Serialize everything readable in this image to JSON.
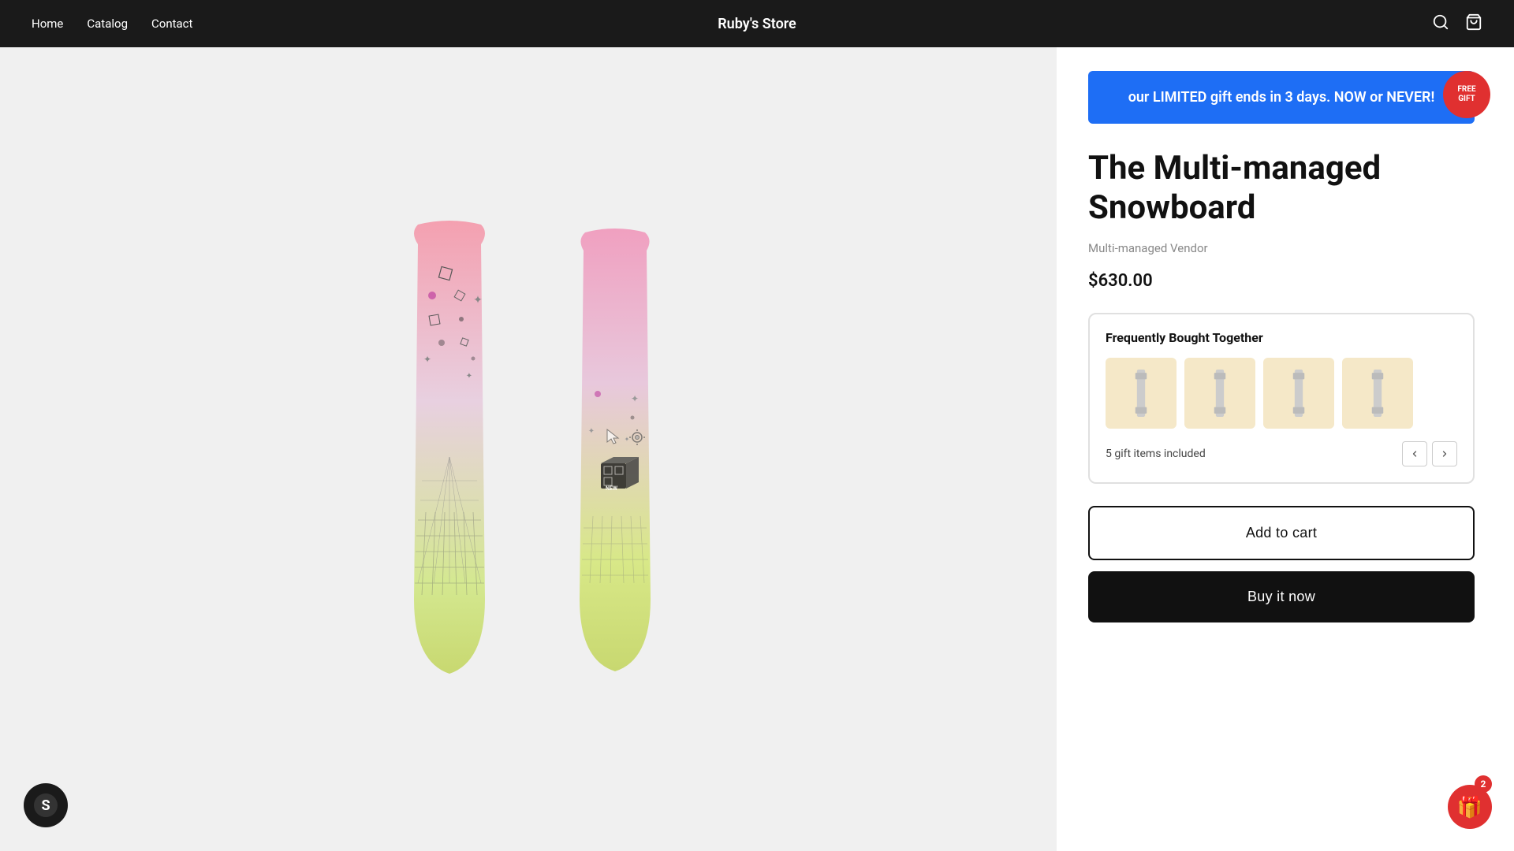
{
  "header": {
    "brand": "Ruby's Store",
    "nav": [
      {
        "label": "Home",
        "href": "#"
      },
      {
        "label": "Catalog",
        "href": "#"
      },
      {
        "label": "Contact",
        "href": "#"
      }
    ],
    "search_label": "Search",
    "cart_label": "Cart"
  },
  "banner": {
    "text": "our LIMITED gift ends in 3 days. NOW or NEVER!"
  },
  "product": {
    "title": "The Multi-managed Snowboard",
    "vendor": "Multi-managed Vendor",
    "price": "$630.00",
    "free_gift_badge_line1": "FREE",
    "free_gift_badge_line2": "GIFT"
  },
  "fbt": {
    "title": "Frequently Bought Together",
    "items_count_label": "5 gift items included",
    "item_count": 4
  },
  "buttons": {
    "add_to_cart": "Add to cart",
    "buy_now": "Buy it now"
  },
  "gift_widget": {
    "count": "2"
  }
}
